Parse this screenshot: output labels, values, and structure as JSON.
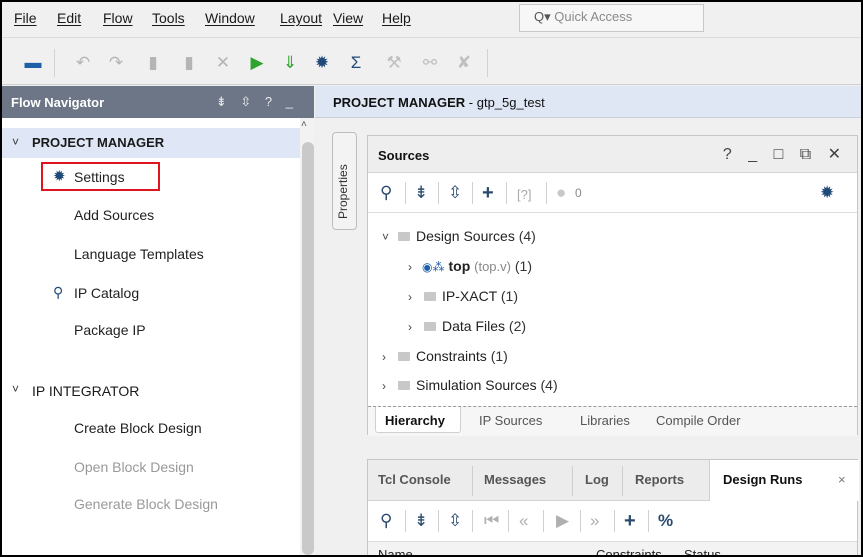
{
  "menubar": {
    "items": [
      "File",
      "Edit",
      "Flow",
      "Tools",
      "Window",
      "Layout",
      "View",
      "Help"
    ],
    "quick_access_placeholder": "Quick Access"
  },
  "flow_navigator": {
    "title": "Flow Navigator",
    "header_icons": "⇟ ⇳ ? _",
    "sections": [
      {
        "label": "PROJECT MANAGER",
        "items": [
          {
            "label": "Settings",
            "icon": "gear-icon",
            "enabled": true
          },
          {
            "label": "Add Sources",
            "enabled": true
          },
          {
            "label": "Language Templates",
            "enabled": true
          },
          {
            "label": "IP Catalog",
            "icon": "plug-icon",
            "enabled": true
          },
          {
            "label": "Package IP",
            "enabled": true
          }
        ]
      },
      {
        "label": "IP INTEGRATOR",
        "items": [
          {
            "label": "Create Block Design",
            "enabled": true
          },
          {
            "label": "Open Block Design",
            "enabled": false
          },
          {
            "label": "Generate Block Design",
            "enabled": false
          }
        ]
      }
    ]
  },
  "project_manager": {
    "header_bold": "PROJECT MANAGER",
    "header_rest": " - gtp_5g_test"
  },
  "properties_tab": "Properties",
  "sources": {
    "title": "Sources",
    "controls": "? _ □ ⧉ ✕",
    "error_count": "0",
    "tree": {
      "design_sources": {
        "label": "Design Sources",
        "count": "(4)"
      },
      "top": {
        "label": "top",
        "file": "(top.v)",
        "count": "(1)"
      },
      "ip_xact": {
        "label": "IP-XACT",
        "count": "(1)"
      },
      "data_files": {
        "label": "Data Files",
        "count": "(2)"
      },
      "constraints": {
        "label": "Constraints",
        "count": "(1)"
      },
      "simulation_sources": {
        "label": "Simulation Sources",
        "count": "(4)"
      }
    },
    "tabs": [
      "Hierarchy",
      "IP Sources",
      "Libraries",
      "Compile Order"
    ]
  },
  "bottom_panel": {
    "tabs": [
      "Tcl Console",
      "Messages",
      "Log",
      "Reports",
      "Design Runs"
    ],
    "active_tab": "Design Runs",
    "close": "×",
    "columns": [
      "Name",
      "Constraints",
      "Status"
    ]
  },
  "colors": {
    "flow_nav_header": "#6c7686",
    "selected_section": "#dfe7f6",
    "highlight_box": "#e0141e",
    "run_green": "#2ea32e",
    "folder_blue": "#1f5fa8"
  }
}
